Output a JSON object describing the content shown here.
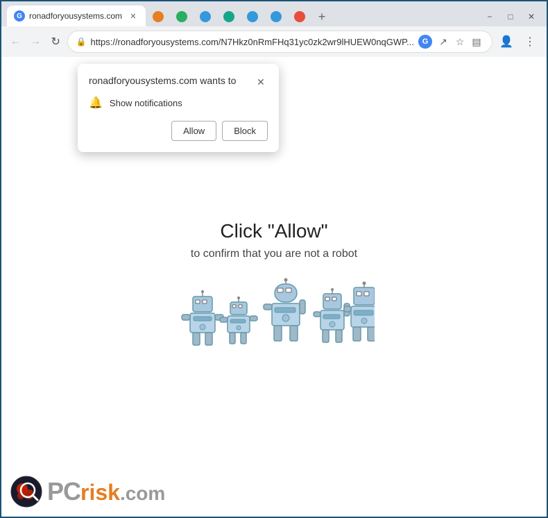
{
  "browser": {
    "tabs": [
      {
        "id": "tab1",
        "favicon_color": "#4285f4",
        "favicon_label": "G",
        "label": "ronadforyousystems.com",
        "active": true
      },
      {
        "id": "tab2",
        "favicon_color": "#e67e22",
        "label": "",
        "active": false
      },
      {
        "id": "tab3",
        "favicon_color": "#27ae60",
        "label": "",
        "active": false
      },
      {
        "id": "tab4",
        "favicon_color": "#3498db",
        "label": "",
        "active": false
      },
      {
        "id": "tab5",
        "favicon_color": "#17a589",
        "label": "",
        "active": false
      },
      {
        "id": "tab6",
        "favicon_color": "#3498db",
        "label": "",
        "active": false
      },
      {
        "id": "tab7",
        "favicon_color": "#3498db",
        "label": "",
        "active": false
      },
      {
        "id": "tab8",
        "favicon_color": "#e74c3c",
        "label": "",
        "active": false
      }
    ],
    "new_tab_button": "+",
    "window_controls": {
      "minimize": "−",
      "maximize": "□",
      "close": "✕"
    },
    "nav": {
      "back": "←",
      "forward": "→",
      "reload": "↻"
    },
    "address_bar": {
      "lock_icon": "🔒",
      "url": "https://ronadforyousystems.com/N7Hkz0nRmFHq31yc0zk2wr9lHUEW0nqGWP...",
      "google_icon": "G"
    },
    "toolbar_icons": {
      "cast": "▭",
      "bookmark": "☆",
      "sidebar": "▤",
      "account": "👤",
      "menu": "⋮"
    }
  },
  "notification_popup": {
    "title": "ronadforyousystems.com wants to",
    "close_btn": "✕",
    "notification_row": {
      "bell": "🔔",
      "text": "Show notifications"
    },
    "allow_btn": "Allow",
    "block_btn": "Block"
  },
  "page": {
    "heading": "Click \"Allow\"",
    "subtext": "to confirm that you are not a robot"
  },
  "watermark": {
    "pc_text": "PC",
    "risk_text": "risk",
    "com_text": ".com"
  }
}
